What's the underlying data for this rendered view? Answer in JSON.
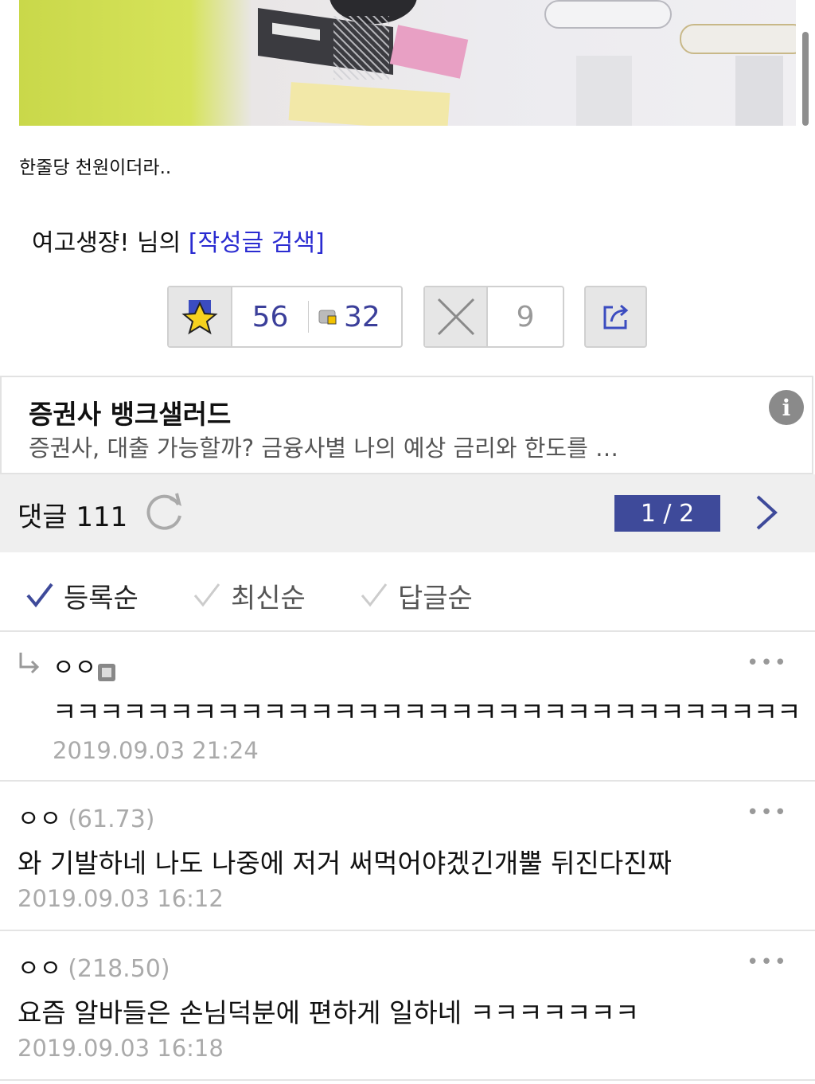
{
  "post": {
    "caption": "한줄당 천원이더라..",
    "author": "여고생쟝!",
    "author_suffix": "님의",
    "search_link": "[작성글 검색]"
  },
  "votes": {
    "recommend": "56",
    "comments_badge": "32",
    "dislike": "9"
  },
  "ad": {
    "title": "증권사 뱅크샐러드",
    "description": "증권사, 대출 가능할까? 금융사별 나의 예상 금리와 한도를 …",
    "info_icon": "i"
  },
  "comments_header": {
    "label": "댓글 111",
    "page": "1 / 2"
  },
  "sort_tabs": [
    {
      "label": "등록순",
      "active": true
    },
    {
      "label": "최신순",
      "active": false
    },
    {
      "label": "답글순",
      "active": false
    }
  ],
  "comments": [
    {
      "nick": "ㅇㅇ",
      "reply": true,
      "text": "ㅋㅋㅋㅋㅋㅋㅋㅋㅋㅋㅋㅋㅋㅋㅋㅋㅋㅋㅋㅋㅋㅋㅋㅋㅋㅋㅋㅋㅋㅋㅋㅋ",
      "date": "2019.09.03 21:24"
    },
    {
      "nick": "ㅇㅇ",
      "score": "(61.73)",
      "text": "와 기발하네 나도 나중에 저거 써먹어야겠긴개뿔 뒤진다진짜",
      "date": "2019.09.03 16:12"
    },
    {
      "nick": "ㅇㅇ",
      "score": "(218.50)",
      "text": "요즘 알바들은 손님덕분에 편하게 일하네 ㅋㅋㅋㅋㅋㅋㅋ",
      "date": "2019.09.03 16:18"
    }
  ],
  "more_icon": "•••",
  "colors": {
    "link_blue": "#2a2bd1",
    "count_blue": "#3b3f9a",
    "page_badge": "#3e4a9a",
    "header_bg": "#efefef"
  }
}
